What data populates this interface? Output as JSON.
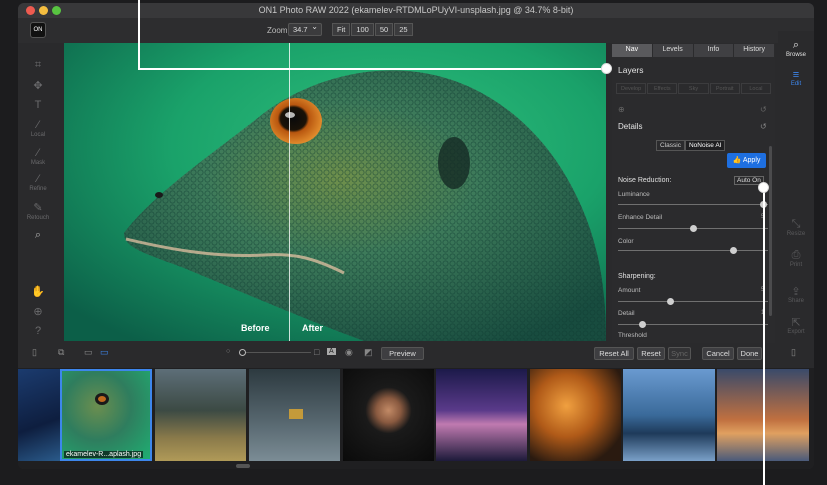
{
  "app": {
    "title": "ON1 Photo RAW 2022 (ekamelev-RTDMLoPUyVI-unsplash.jpg @ 34.7% 8-bit)",
    "logo": "ON"
  },
  "toolbar": {
    "zoom_label": "Zoom:",
    "zoom_value": "34.7",
    "zoom_buttons": [
      "Fit",
      "100",
      "50",
      "25"
    ]
  },
  "left_tools": [
    {
      "icon": "crop-icon",
      "glyph": "⌗",
      "label": ""
    },
    {
      "icon": "transform-icon",
      "glyph": "✥",
      "label": ""
    },
    {
      "icon": "text-icon",
      "glyph": "T",
      "label": ""
    },
    {
      "icon": "local-brush-icon",
      "glyph": "⁄",
      "label": "Local"
    },
    {
      "icon": "mask-brush-icon",
      "glyph": "⁄",
      "label": "Mask"
    },
    {
      "icon": "refine-brush-icon",
      "glyph": "⁄",
      "label": "Refine"
    },
    {
      "icon": "retouch-icon",
      "glyph": "✎",
      "label": "Retouch"
    },
    {
      "icon": "view-icon",
      "glyph": "⌕",
      "label": ""
    },
    {
      "icon": "hand-icon",
      "glyph": "✋",
      "label": ""
    },
    {
      "icon": "zoom-icon",
      "glyph": "⊕",
      "label": ""
    },
    {
      "icon": "help-icon",
      "glyph": "?",
      "label": ""
    }
  ],
  "canvas": {
    "before_label": "Before",
    "after_label": "After"
  },
  "panel": {
    "tabs": [
      "Nav",
      "Levels",
      "Info",
      "History"
    ],
    "active_tab": "Nav",
    "layers_label": "Layers",
    "subtabs": [
      "Develop",
      "Effects",
      "Sky",
      "Portrait",
      "Local"
    ],
    "details_label": "Details",
    "mode_buttons": [
      "Classic",
      "NoNoise AI"
    ],
    "apply_label": "Apply",
    "noise_reduction_label": "Noise Reduction:",
    "auto_on_label": "Auto On",
    "noise_sliders": [
      {
        "label": "Luminance",
        "value": 0.99,
        "readout": ""
      },
      {
        "label": "Enhance Detail",
        "value": 0.5,
        "readout": "5"
      },
      {
        "label": "Color",
        "value": 0.78,
        "readout": ""
      }
    ],
    "sharpening_label": "Sharpening:",
    "sharpen_sliders": [
      {
        "label": "Amount",
        "value": 0.34,
        "readout": "5"
      },
      {
        "label": "Detail",
        "value": 0.15,
        "readout": "1"
      },
      {
        "label": "Threshold",
        "value": 0.02,
        "readout": ""
      }
    ]
  },
  "right_rail": [
    {
      "icon": "browse-icon",
      "glyph": "⌕",
      "label": "Browse",
      "state": "on"
    },
    {
      "icon": "edit-icon",
      "glyph": "≡",
      "label": "Edit",
      "state": "edit"
    },
    {
      "icon": "resize-icon",
      "glyph": "⤡",
      "label": "Resize",
      "state": "off"
    },
    {
      "icon": "print-icon",
      "glyph": "⎙",
      "label": "Print",
      "state": "off"
    },
    {
      "icon": "share-icon",
      "glyph": "⇪",
      "label": "Share",
      "state": "off"
    },
    {
      "icon": "export-icon",
      "glyph": "⇱",
      "label": "Export",
      "state": "off"
    }
  ],
  "bottom": {
    "preview_label": "Preview",
    "reset_all_label": "Reset All",
    "reset_label": "Reset",
    "sync_label": "Sync",
    "cancel_label": "Cancel",
    "done_label": "Done"
  },
  "filmstrip": {
    "selected_label": "ekamelev-R...aplash.jpg",
    "items": [
      "galaxy",
      "lizard",
      "misty-forest",
      "hiker",
      "portrait",
      "purple-sky",
      "autumn-tree",
      "city-skyline",
      "golden-gate"
    ]
  },
  "colors": {
    "accent": "#3d86ec",
    "apply": "#1e6fe0",
    "panel_bg": "#2b2b2d"
  }
}
